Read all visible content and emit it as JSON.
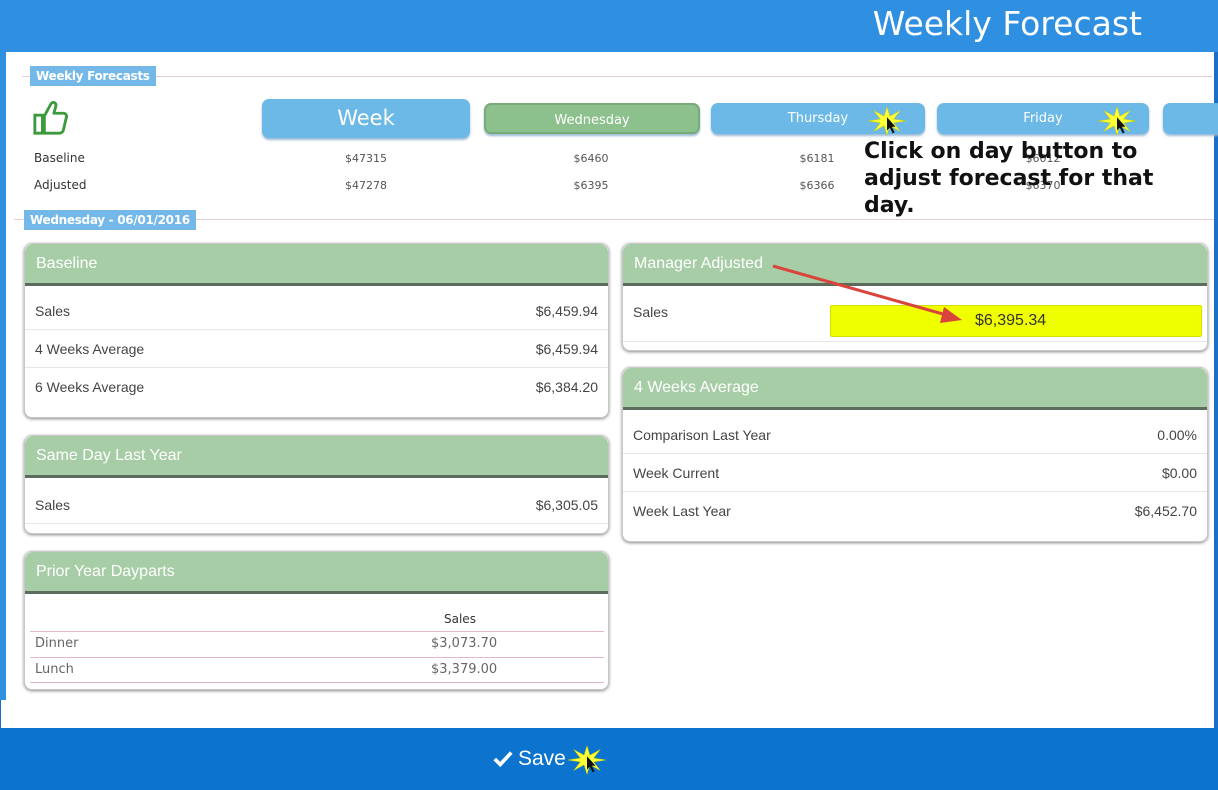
{
  "header": {
    "title": "Weekly Forecast"
  },
  "weekly_forecasts": {
    "section_label": "Weekly Forecasts",
    "buttons": [
      "Week",
      "Wednesday",
      "Thursday",
      "Friday"
    ],
    "baseline_label": "Baseline",
    "adjusted_label": "Adjusted",
    "baseline_values": [
      "$47315",
      "$6460",
      "$6181",
      "$6012"
    ],
    "adjusted_values": [
      "$47278",
      "$6395",
      "$6366",
      "$6370"
    ]
  },
  "callout": {
    "text": "Click on day button to adjust forecast for that day."
  },
  "day_section": {
    "label": "Wednesday - 06/01/2016"
  },
  "baseline_panel": {
    "title": "Baseline",
    "rows": [
      {
        "label": "Sales",
        "value": "$6,459.94"
      },
      {
        "label": "4 Weeks Average",
        "value": "$6,459.94"
      },
      {
        "label": "6 Weeks Average",
        "value": "$6,384.20"
      }
    ]
  },
  "same_day_panel": {
    "title": "Same Day Last Year",
    "rows": [
      {
        "label": "Sales",
        "value": "$6,305.05"
      }
    ]
  },
  "prior_year_panel": {
    "title": "Prior Year Dayparts",
    "column": "Sales",
    "rows": [
      {
        "label": "Dinner",
        "value": "$3,073.70"
      },
      {
        "label": "Lunch",
        "value": "$3,379.00"
      }
    ]
  },
  "manager_panel": {
    "title": "Manager Adjusted",
    "sales_label": "Sales",
    "sales_value": "$6,395.34"
  },
  "four_weeks_panel": {
    "title": "4 Weeks Average",
    "rows": [
      {
        "label": "Comparison Last Year",
        "value": "0.00%"
      },
      {
        "label": "Week Current",
        "value": "$0.00"
      },
      {
        "label": "Week Last Year",
        "value": "$6,452.70"
      }
    ]
  },
  "footer": {
    "save_label": "Save"
  },
  "colors": {
    "header_blue": "#2f8fe0",
    "footer_blue": "#0c74cf",
    "panel_green": "#a7cda7",
    "highlight_yellow": "#f0ff00",
    "arrow_red": "#d9453d"
  }
}
